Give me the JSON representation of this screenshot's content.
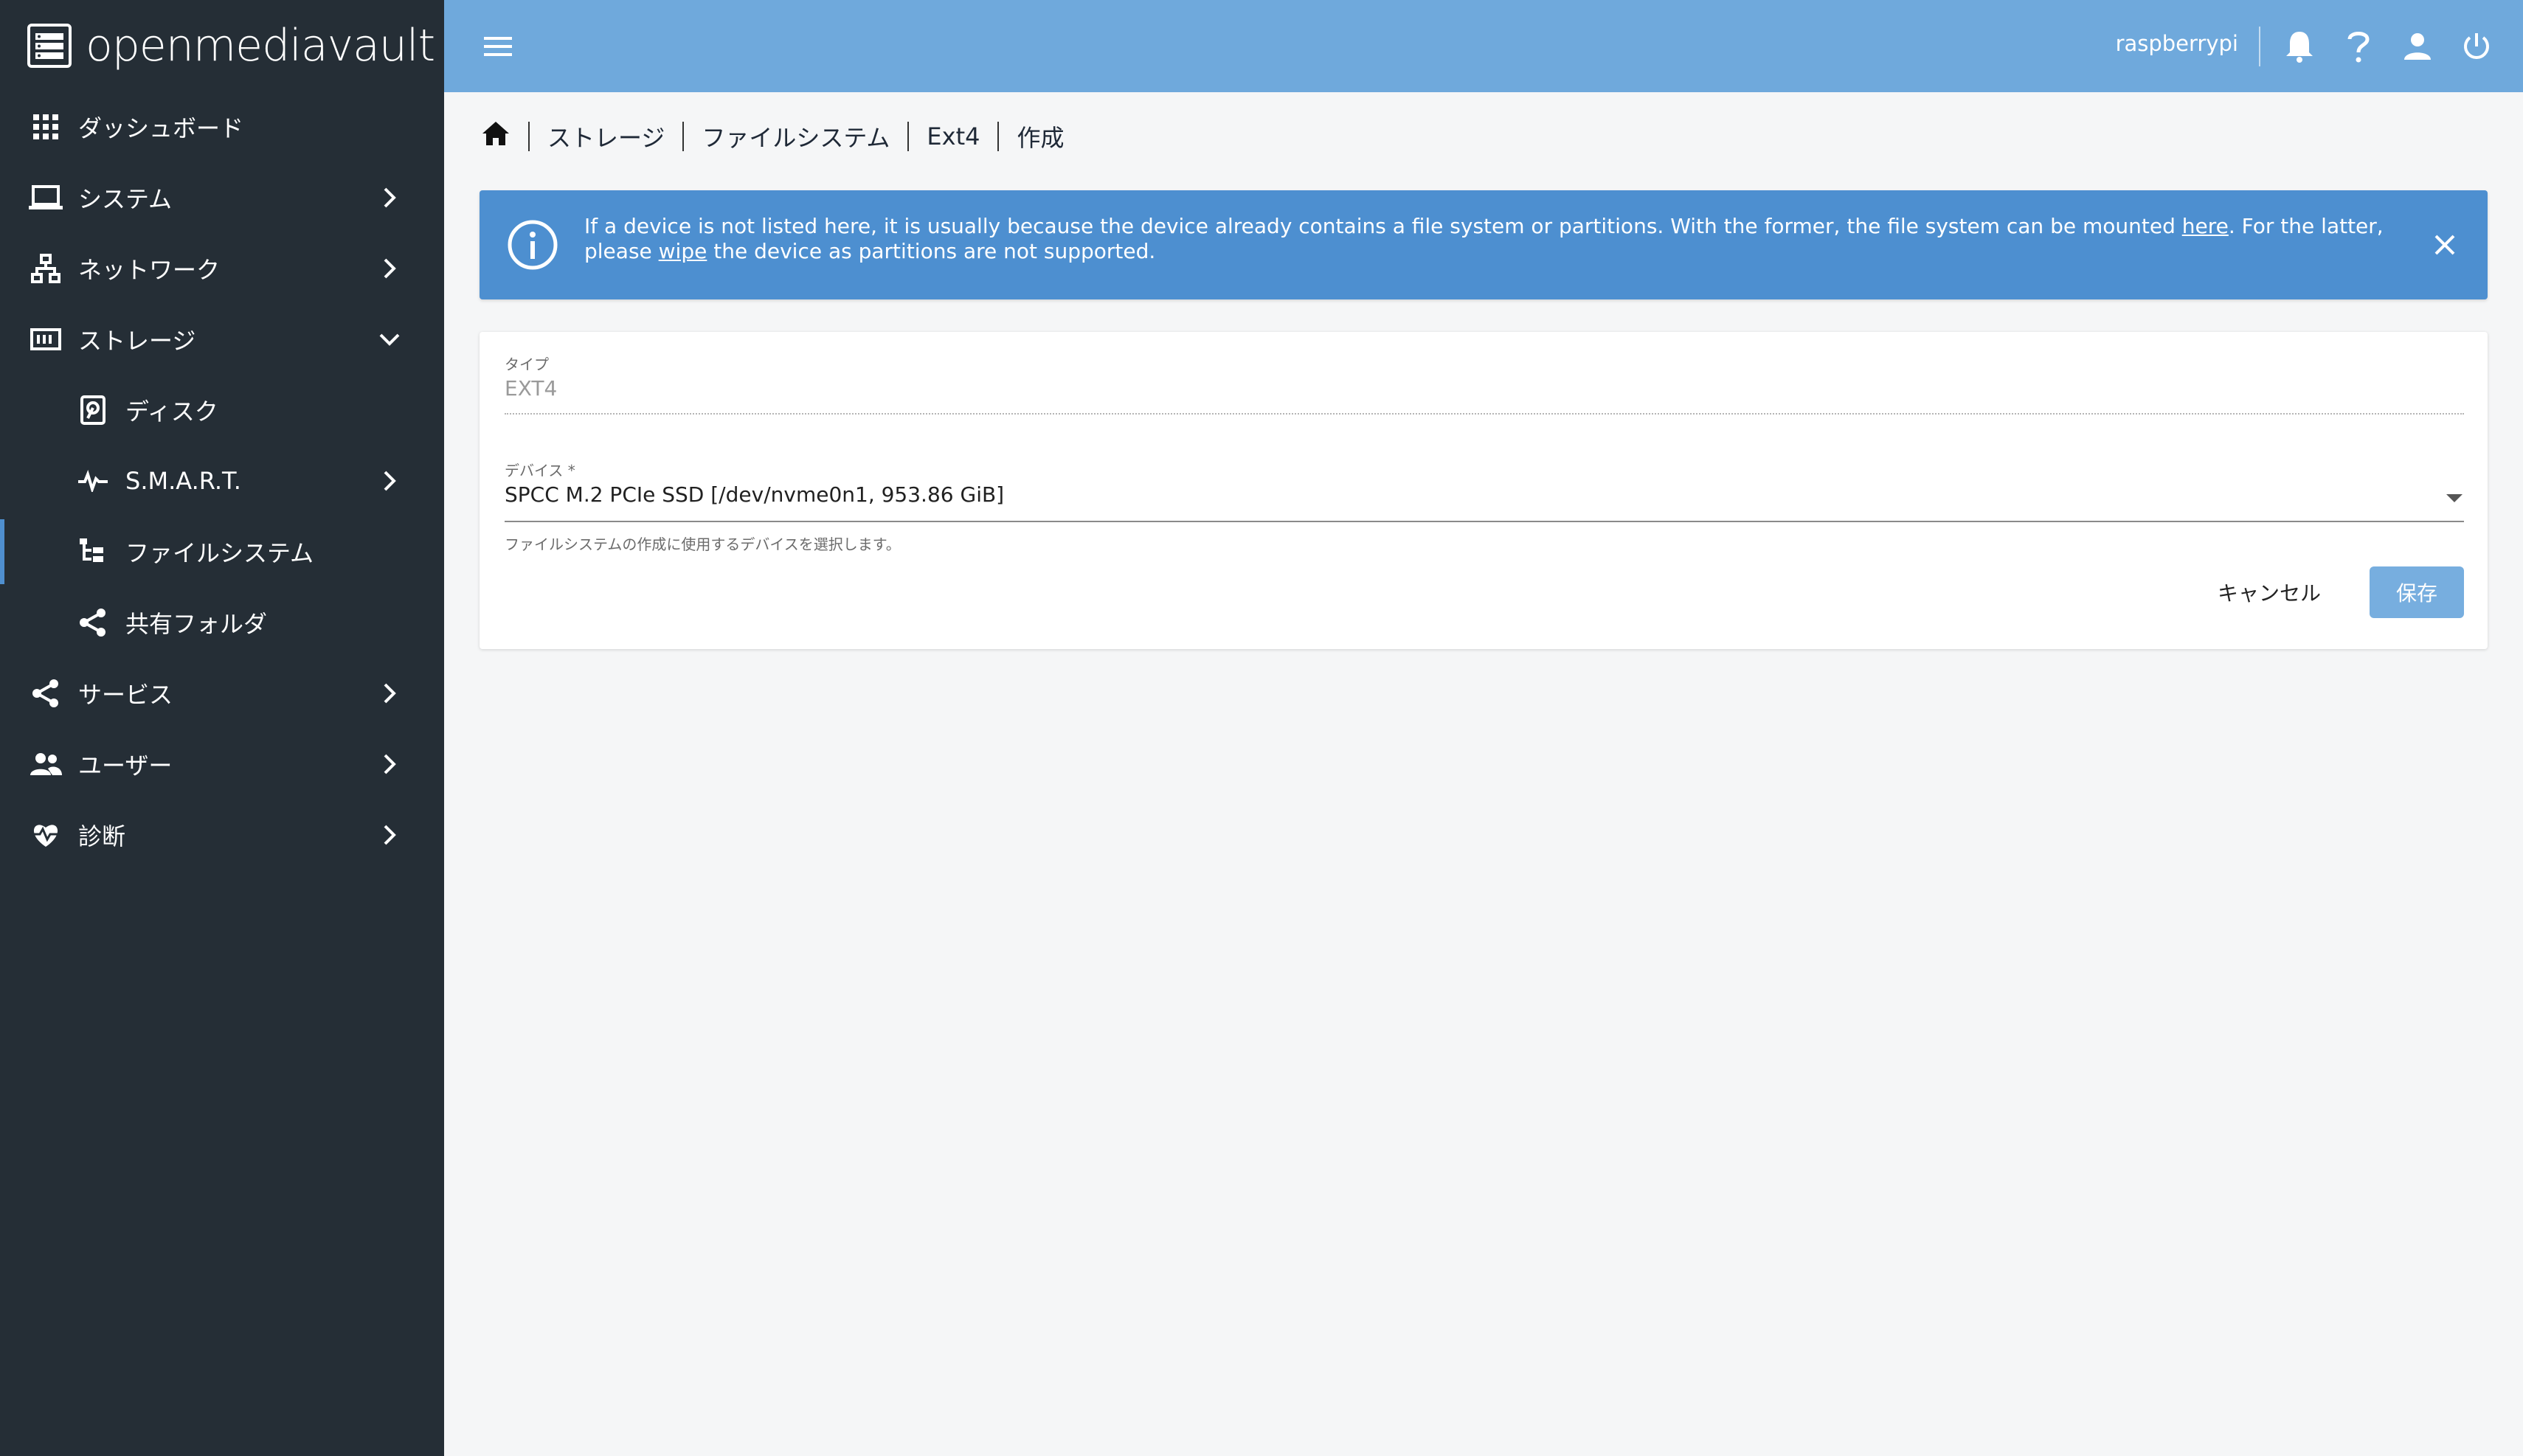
{
  "app": {
    "brand": "openmediavault"
  },
  "sidebar": {
    "items": [
      {
        "label": "ダッシュボード",
        "icon": "grid-icon"
      },
      {
        "label": "システム",
        "icon": "laptop-icon"
      },
      {
        "label": "ネットワーク",
        "icon": "network-icon"
      },
      {
        "label": "ストレージ",
        "icon": "storage-icon"
      },
      {
        "label": "ディスク",
        "icon": "disk-icon"
      },
      {
        "label": "S.M.A.R.T.",
        "icon": "pulse-icon"
      },
      {
        "label": "ファイルシステム",
        "icon": "filesystem-icon"
      },
      {
        "label": "共有フォルダ",
        "icon": "share-icon"
      },
      {
        "label": "サービス",
        "icon": "share-icon"
      },
      {
        "label": "ユーザー",
        "icon": "users-icon"
      },
      {
        "label": "診断",
        "icon": "heart-pulse-icon"
      }
    ]
  },
  "topbar": {
    "hostname": "raspberrypi"
  },
  "breadcrumb": {
    "items": [
      "ストレージ",
      "ファイルシステム",
      "Ext4",
      "作成"
    ]
  },
  "alert": {
    "text_part1": "If a device is not listed here, it is usually because the device already contains a file system or partitions. With the former, the file system can be mounted ",
    "link_here": "here",
    "text_part2": ". For the latter, please ",
    "link_wipe": "wipe",
    "text_part3": " the device as partitions are not supported."
  },
  "form": {
    "type_label": "タイプ",
    "type_value": "EXT4",
    "device_label": "デバイス *",
    "device_value": "SPCC M.2 PCIe SSD [/dev/nvme0n1, 953.86 GiB]",
    "device_hint": "ファイルシステムの作成に使用するデバイスを選択します。",
    "cancel_label": "キャンセル",
    "save_label": "保存"
  },
  "colors": {
    "sidebar_bg": "#252e36",
    "topbar_bg": "#6fa9dc",
    "alert_bg": "#4d8fd0",
    "save_bg": "#77aedf"
  }
}
